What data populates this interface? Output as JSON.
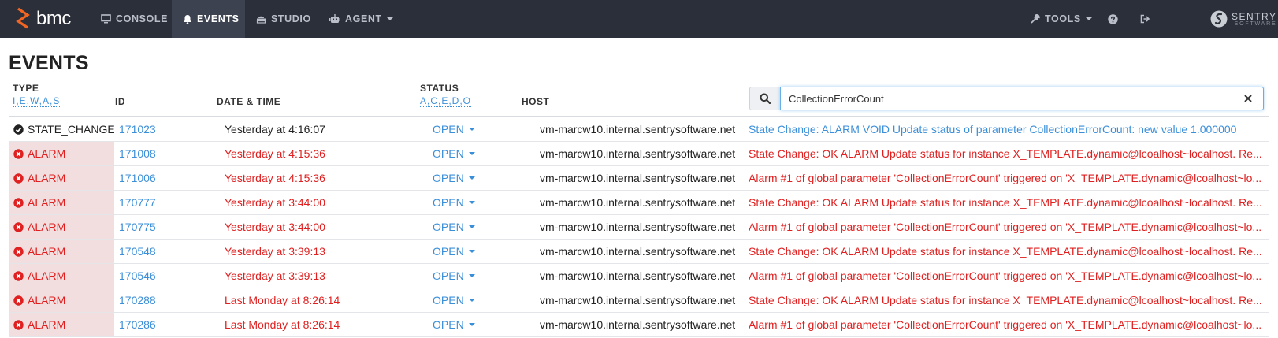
{
  "navbar": {
    "brand": "bmc",
    "items": [
      {
        "label": "CONSOLE",
        "icon": "monitor-icon"
      },
      {
        "label": "EVENTS",
        "icon": "bell-icon",
        "active": true
      },
      {
        "label": "STUDIO",
        "icon": "studio-icon"
      },
      {
        "label": "AGENT",
        "icon": "robot-icon"
      }
    ],
    "tools_label": "TOOLS",
    "partner": {
      "name": "SENTRY",
      "sub": "SOFTWARE"
    }
  },
  "page": {
    "title": "EVENTS"
  },
  "columns": {
    "type": {
      "label": "TYPE",
      "filter": "I,E,W,A,S"
    },
    "id": {
      "label": "ID"
    },
    "datetime": {
      "label": "DATE & TIME"
    },
    "status": {
      "label": "STATUS",
      "filter": "A,C,E,D,O"
    },
    "host": {
      "label": "HOST"
    }
  },
  "search": {
    "value": "CollectionErrorCount"
  },
  "rows": [
    {
      "kind": "ok",
      "type": "STATE_CHANGE",
      "id": "171023",
      "datetime": "Yesterday at 4:16:07",
      "status": "OPEN",
      "host": "vm-marcw10.internal.sentrysoftware.net",
      "message": "State Change: ALARM VOID Update status of parameter CollectionErrorCount: new value 1.000000"
    },
    {
      "kind": "alarm",
      "type": "ALARM",
      "id": "171008",
      "datetime": "Yesterday at 4:15:36",
      "status": "OPEN",
      "host": "vm-marcw10.internal.sentrysoftware.net",
      "message": "State Change: OK ALARM Update status for instance X_TEMPLATE.dynamic@lcoalhost~localhost. Re..."
    },
    {
      "kind": "alarm",
      "type": "ALARM",
      "id": "171006",
      "datetime": "Yesterday at 4:15:36",
      "status": "OPEN",
      "host": "vm-marcw10.internal.sentrysoftware.net",
      "message": "Alarm #1 of global parameter 'CollectionErrorCount' triggered on 'X_TEMPLATE.dynamic@lcoalhost~lo..."
    },
    {
      "kind": "alarm",
      "type": "ALARM",
      "id": "170777",
      "datetime": "Yesterday at 3:44:00",
      "status": "OPEN",
      "host": "vm-marcw10.internal.sentrysoftware.net",
      "message": "State Change: OK ALARM Update status for instance X_TEMPLATE.dynamic@lcoalhost~localhost. Re..."
    },
    {
      "kind": "alarm",
      "type": "ALARM",
      "id": "170775",
      "datetime": "Yesterday at 3:44:00",
      "status": "OPEN",
      "host": "vm-marcw10.internal.sentrysoftware.net",
      "message": "Alarm #1 of global parameter 'CollectionErrorCount' triggered on 'X_TEMPLATE.dynamic@lcoalhost~lo..."
    },
    {
      "kind": "alarm",
      "type": "ALARM",
      "id": "170548",
      "datetime": "Yesterday at 3:39:13",
      "status": "OPEN",
      "host": "vm-marcw10.internal.sentrysoftware.net",
      "message": "State Change: OK ALARM Update status for instance X_TEMPLATE.dynamic@lcoalhost~localhost. Re..."
    },
    {
      "kind": "alarm",
      "type": "ALARM",
      "id": "170546",
      "datetime": "Yesterday at 3:39:13",
      "status": "OPEN",
      "host": "vm-marcw10.internal.sentrysoftware.net",
      "message": "Alarm #1 of global parameter 'CollectionErrorCount' triggered on 'X_TEMPLATE.dynamic@lcoalhost~lo..."
    },
    {
      "kind": "alarm",
      "type": "ALARM",
      "id": "170288",
      "datetime": "Last Monday at 8:26:14",
      "status": "OPEN",
      "host": "vm-marcw10.internal.sentrysoftware.net",
      "message": "State Change: OK ALARM Update status for instance X_TEMPLATE.dynamic@lcoalhost~localhost. Re..."
    },
    {
      "kind": "alarm",
      "type": "ALARM",
      "id": "170286",
      "datetime": "Last Monday at 8:26:14",
      "status": "OPEN",
      "host": "vm-marcw10.internal.sentrysoftware.net",
      "message": "Alarm #1 of global parameter 'CollectionErrorCount' triggered on 'X_TEMPLATE.dynamic@lcoalhost~lo..."
    }
  ],
  "colors": {
    "navbar": "#2a2f3a",
    "link": "#3b8fd9",
    "alarm": "#e02020",
    "alarm_bg": "#f2dede",
    "brand_orange": "#f26522"
  }
}
